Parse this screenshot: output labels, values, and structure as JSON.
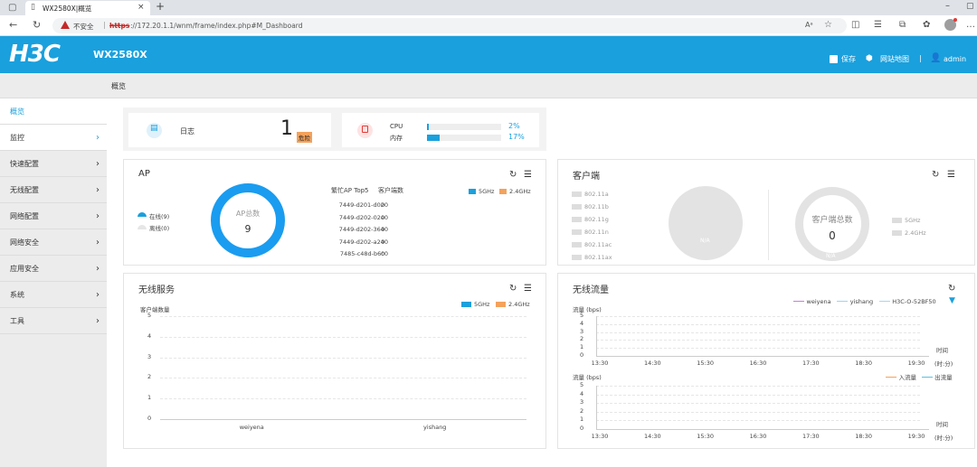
{
  "browser": {
    "tab_title": "WX2580X|概览",
    "security": "不安全",
    "url_https": "https",
    "url_rest": "://172.20.1.1/wnm/frame/index.php#M_Dashboard"
  },
  "header": {
    "logo": "H3C",
    "model": "WX2580X",
    "save": "保存",
    "sitemap": "网站地图",
    "user": "admin"
  },
  "breadcrumb": "概览",
  "sidebar": {
    "items": [
      {
        "label": "概览"
      },
      {
        "label": "监控"
      },
      {
        "label": "快速配置"
      },
      {
        "label": "无线配置"
      },
      {
        "label": "网络配置"
      },
      {
        "label": "网络安全"
      },
      {
        "label": "应用安全"
      },
      {
        "label": "系统"
      },
      {
        "label": "工具"
      }
    ]
  },
  "log_card": {
    "label": "日志",
    "count": "1",
    "badge": "危险"
  },
  "resource_card": {
    "cpu_label": "CPU",
    "cpu_value": "2%",
    "cpu_pct": 2,
    "mem_label": "内存",
    "mem_value": "17%",
    "mem_pct": 17
  },
  "ap_panel": {
    "title": "AP",
    "online": "在线(9)",
    "offline": "离线(0)",
    "donut_label": "AP总数",
    "donut_value": "9",
    "top5_title": "繁忙AP Top5",
    "clients_col": "客户端数",
    "legend_5g": "5GHz",
    "legend_24g": "2.4GHz",
    "rows": [
      {
        "name": "7449-d201-d020",
        "value": "0"
      },
      {
        "name": "7449-d202-02e0",
        "value": "0"
      },
      {
        "name": "7449-d202-3640",
        "value": "0"
      },
      {
        "name": "7449-d202-a240",
        "value": "0"
      },
      {
        "name": "7485-c48d-b6c0",
        "value": "0"
      }
    ]
  },
  "client_panel": {
    "title": "客户端",
    "modes": [
      "802.11a",
      "802.11b",
      "802.11g",
      "802.11n",
      "802.11ac",
      "802.11ax"
    ],
    "pie_na": "N/A",
    "donut_label": "客户端总数",
    "donut_value": "0",
    "donut_na": "N/A",
    "band_5g": "5GHz",
    "band_24g": "2.4GHz"
  },
  "wireless_service": {
    "title": "无线服务",
    "legend_5g": "5GHz",
    "legend_24g": "2.4GHz",
    "ylabel": "客户端数量",
    "yticks": [
      "5",
      "4",
      "3",
      "2",
      "1",
      "0"
    ],
    "categories": [
      "weiyena",
      "yishang"
    ]
  },
  "traffic_panel": {
    "title": "无线流量",
    "legend": [
      "weiyena",
      "yishang",
      "H3C-O-52BF50"
    ],
    "ylabel": "流量 (bps)",
    "yticks": [
      "5",
      "4",
      "3",
      "2",
      "1",
      "0"
    ],
    "xticks": [
      "13:30",
      "14:30",
      "15:30",
      "16:30",
      "17:30",
      "18:30",
      "19:30"
    ],
    "xlabel_1": "时间",
    "xlabel_2": "(时:分)",
    "legend_in": "入流量",
    "legend_out": "出流量"
  },
  "chart_data": [
    {
      "type": "bar",
      "ylabel": "客户端数量",
      "categories": [
        "weiyena",
        "yishang"
      ],
      "series": [
        {
          "name": "5GHz",
          "values": [
            0,
            0
          ]
        },
        {
          "name": "2.4GHz",
          "values": [
            0,
            0
          ]
        }
      ],
      "ylim": [
        0,
        5
      ],
      "legend": "top-right",
      "grid": true
    },
    {
      "type": "line",
      "ylabel": "流量 (bps)",
      "xlabel": "时间 (时:分)",
      "x": [
        "13:30",
        "14:30",
        "15:30",
        "16:30",
        "17:30",
        "18:30",
        "19:30"
      ],
      "series": [
        {
          "name": "weiyena",
          "values": [
            0,
            0,
            0,
            0,
            0,
            0,
            0
          ]
        },
        {
          "name": "yishang",
          "values": [
            0,
            0,
            0,
            0,
            0,
            0,
            0
          ]
        },
        {
          "name": "H3C-O-52BF50",
          "values": [
            0,
            0,
            0,
            0,
            0,
            0,
            0
          ]
        }
      ],
      "ylim": [
        0,
        5
      ],
      "legend": "top-right"
    },
    {
      "type": "line",
      "ylabel": "流量 (bps)",
      "xlabel": "时间 (时:分)",
      "x": [
        "13:30",
        "14:30",
        "15:30",
        "16:30",
        "17:30",
        "18:30",
        "19:30"
      ],
      "series": [
        {
          "name": "入流量",
          "values": [
            0,
            0,
            0,
            0,
            0,
            0,
            0
          ]
        },
        {
          "name": "出流量",
          "values": [
            0,
            0,
            0,
            0,
            0,
            0,
            0
          ]
        }
      ],
      "ylim": [
        0,
        5
      ],
      "legend": "top-right"
    }
  ],
  "colors": {
    "brand": "#1aa0dd",
    "band_5g": "#1aa0dd",
    "band_24g": "#f4a25c",
    "danger_badge": "#f4a25c",
    "weiyena": "#c77dd6",
    "yishang": "#9fd3ee",
    "h3c": "#a9d6ee",
    "in_traffic": "#f4a25c",
    "out_traffic": "#5bc0de"
  }
}
